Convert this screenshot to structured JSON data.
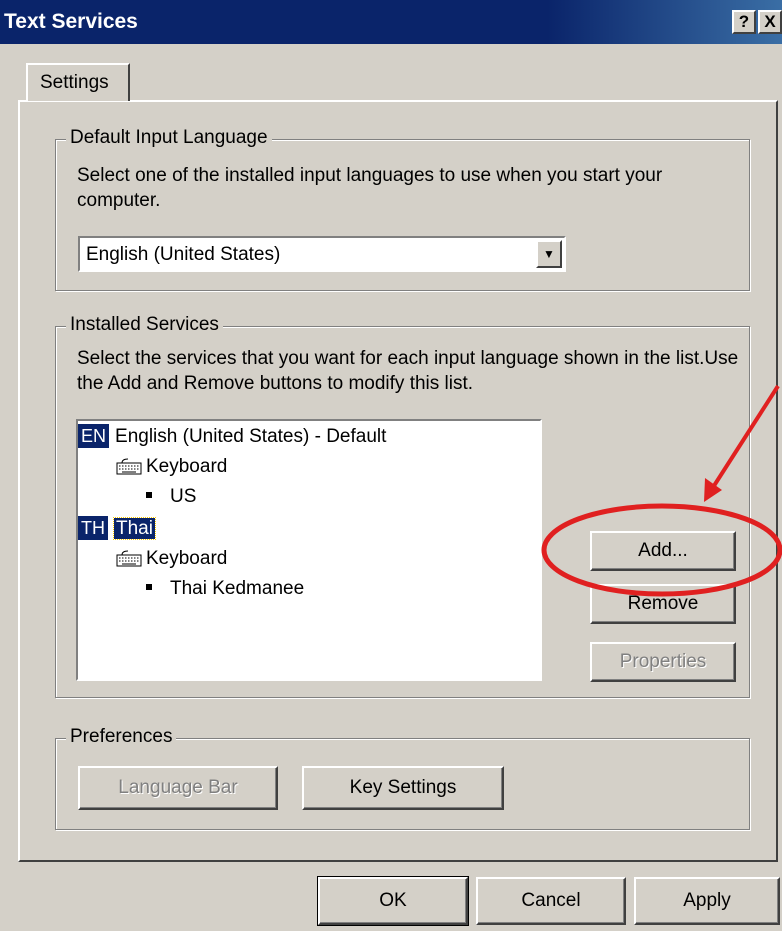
{
  "window": {
    "title": "Text Services",
    "help_button": "?",
    "close_button": "X"
  },
  "tabs": [
    {
      "label": "Settings"
    }
  ],
  "default_input_language": {
    "legend": "Default Input Language",
    "description": "Select one of the installed input languages to use when you start your computer.",
    "selected_value": "English (United States)"
  },
  "installed_services": {
    "legend": "Installed Services",
    "description": "Select the services that you want for each input language shown in the list.Use the Add and Remove buttons to modify this list.",
    "tree": [
      {
        "badge": "EN",
        "label": "English (United States) - Default",
        "selected": false,
        "children": [
          {
            "label": "Keyboard",
            "icon": "keyboard-icon",
            "items": [
              "US"
            ]
          }
        ]
      },
      {
        "badge": "TH",
        "label": "Thai",
        "selected": true,
        "children": [
          {
            "label": "Keyboard",
            "icon": "keyboard-icon",
            "items": [
              "Thai Kedmanee"
            ]
          }
        ]
      }
    ],
    "buttons": {
      "add": "Add...",
      "remove": "Remove",
      "properties": "Properties"
    }
  },
  "preferences": {
    "legend": "Preferences",
    "buttons": {
      "language_bar": "Language Bar",
      "key_settings": "Key Settings"
    }
  },
  "dialog_buttons": {
    "ok": "OK",
    "cancel": "Cancel",
    "apply": "Apply"
  },
  "colors": {
    "title_bar": "#0a246a",
    "selection": "#0a246a",
    "face": "#d4d0c8",
    "annotation": "#e02020"
  }
}
